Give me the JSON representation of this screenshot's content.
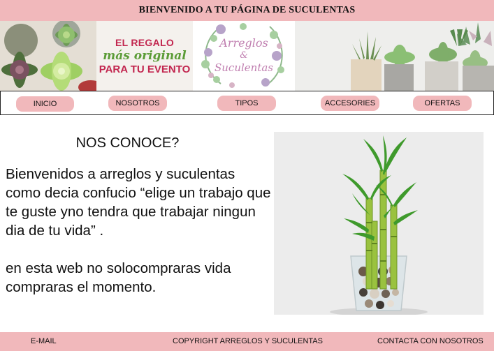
{
  "header": {
    "title": "BIENVENIDO A TU PÁGINA DE SUCULENTAS"
  },
  "banner": {
    "promo_line1": "EL REGALO",
    "promo_line2": "más original",
    "promo_line3": "PARA TU EVENTO",
    "wreath_line1": "Arreglos",
    "wreath_line2": "&",
    "wreath_line3": "Suculentas"
  },
  "nav": {
    "items": [
      {
        "label": "INICIO"
      },
      {
        "label": "NOSOTROS"
      },
      {
        "label": "TIPOS"
      },
      {
        "label": "ACCESORIES"
      },
      {
        "label": "OFERTAS"
      }
    ]
  },
  "main": {
    "title": "NOS CONOCE?",
    "paragraph1": "Bienvenidos a arreglos y suculentas como decia confucio “elige un trabajo que te guste yno tendra que trabajar ningun dia de tu vida” .",
    "paragraph2": "en esta web no solocompraras vida compraras el momento."
  },
  "footer": {
    "email": "E-MAIL",
    "copyright": "COPYRIGHT ARREGLOS Y SUCULENTAS",
    "contact": "CONTACTA CON NOSOTROS"
  },
  "colors": {
    "accent": "#f1b8bb",
    "promo_red": "#c2264f",
    "promo_green": "#5b9c37",
    "wreath_text": "#c07fb0"
  }
}
